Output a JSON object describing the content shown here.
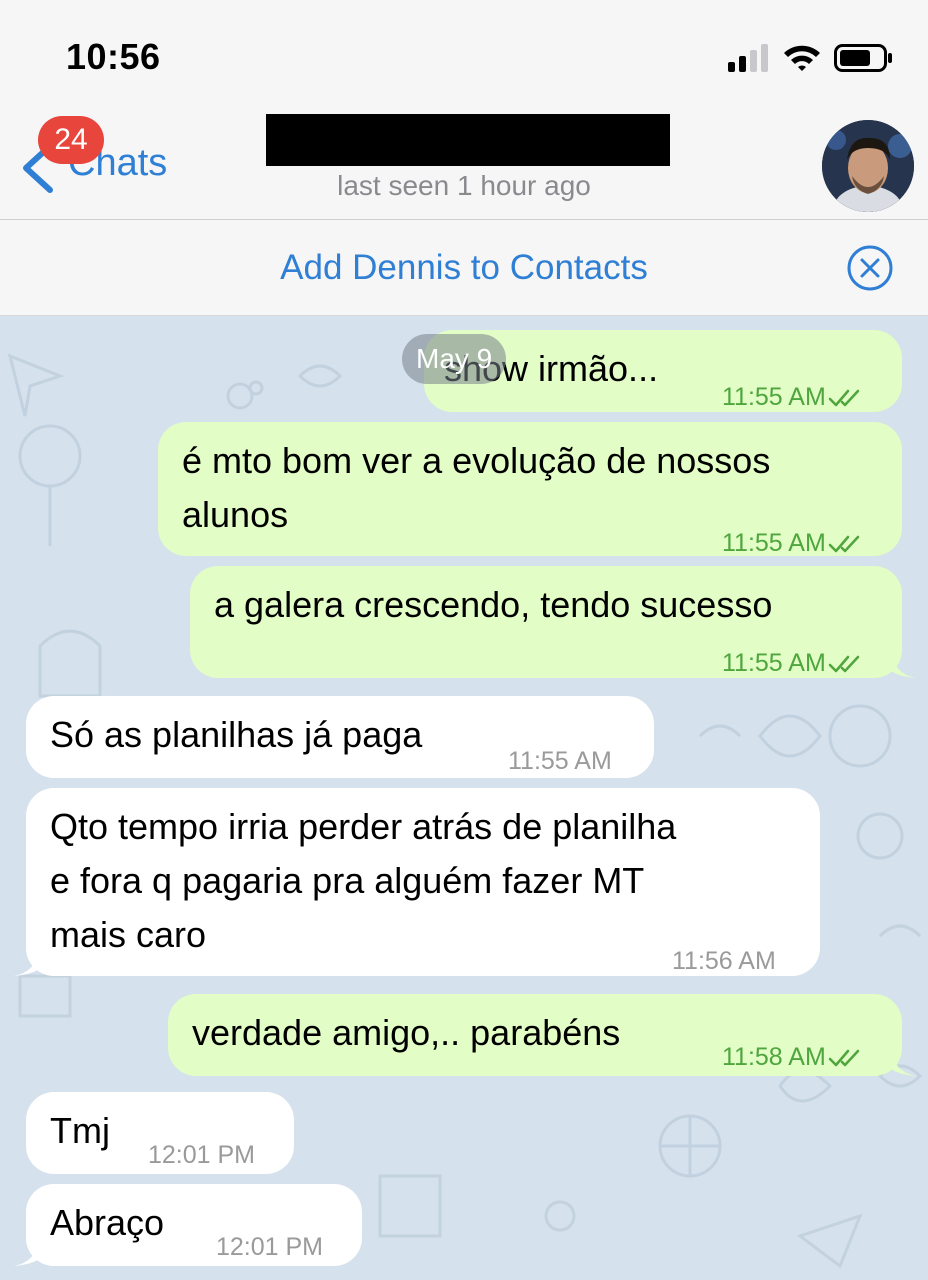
{
  "status_bar": {
    "time": "10:56"
  },
  "nav": {
    "back_label": "Chats",
    "unread_badge": "24",
    "status": "last seen 1 hour ago"
  },
  "banner": {
    "text": "Add Dennis to Contacts"
  },
  "date_pill": "May 9",
  "messages": [
    {
      "direction": "out",
      "lines": [
        "show irmão..."
      ],
      "time": "11:55 AM",
      "read": true
    },
    {
      "direction": "out",
      "lines": [
        "é mto bom ver a evolução de nossos",
        "alunos"
      ],
      "time": "11:55 AM",
      "read": true
    },
    {
      "direction": "out",
      "lines": [
        "a galera crescendo, tendo sucesso"
      ],
      "time": "11:55 AM",
      "read": true
    },
    {
      "direction": "in",
      "lines": [
        "Só as planilhas já paga"
      ],
      "time": "11:55 AM"
    },
    {
      "direction": "in",
      "lines": [
        "Qto tempo irria perder atrás de planilha",
        "e fora q pagaria pra alguém fazer MT",
        "mais caro"
      ],
      "time": "11:56 AM"
    },
    {
      "direction": "out",
      "lines": [
        "verdade amigo,.. parabéns"
      ],
      "time": "11:58 AM",
      "read": true
    },
    {
      "direction": "in",
      "lines": [
        "Tmj"
      ],
      "time": "12:01 PM"
    },
    {
      "direction": "in",
      "lines": [
        "Abraço"
      ],
      "time": "12:01 PM"
    }
  ],
  "colors": {
    "accent": "#2f7fd5",
    "badge": "#e8453c",
    "outgoing_bubble": "#e2fdc5",
    "incoming_bubble": "#ffffff",
    "chat_background": "#d5e1ec",
    "read_ticks": "#4fa53e"
  }
}
